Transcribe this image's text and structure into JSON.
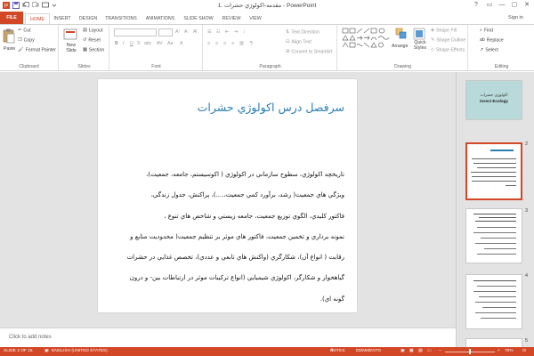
{
  "window": {
    "title": "مقدمه-اكولوژي حشرات .1 - PowerPoint",
    "signin": "Sign in",
    "controls": [
      "?",
      "▭",
      "—",
      "▢",
      "✕"
    ]
  },
  "tabs": [
    "FILE",
    "HOME",
    "INSERT",
    "DESIGN",
    "TRANSITIONS",
    "ANIMATIONS",
    "SLIDE SHOW",
    "REVIEW",
    "VIEW"
  ],
  "ribbon": {
    "clipboard": {
      "label": "Clipboard",
      "paste": "Paste",
      "cut": "Cut",
      "copy": "Copy",
      "format_painter": "Format Painter"
    },
    "slides": {
      "label": "Slides",
      "new_slide": "New Slide",
      "layout": "Layout",
      "reset": "Reset",
      "section": "Section"
    },
    "font": {
      "label": "Font"
    },
    "paragraph": {
      "label": "Paragraph",
      "text_direction": "Text Direction",
      "align_text": "Align Text",
      "convert": "Convert to SmartArt"
    },
    "drawing": {
      "label": "Drawing",
      "arrange": "Arrange",
      "quick_styles": "Quick Styles",
      "shape_fill": "Shape Fill",
      "shape_outline": "Shape Outline",
      "shape_effects": "Shape Effects"
    },
    "editing": {
      "label": "Editing",
      "find": "Find",
      "replace": "Replace",
      "select": "Select"
    }
  },
  "slide": {
    "title": "سرفصل درس اكولوژي حشرات",
    "body": [
      "تاريخچه اكولوژي، سطوح سازماني در اكولوژي ( اكوسيستم، جامعه، جمعيت)،",
      "ويژگي هاي جمعيت( رشد، برآورد كمي جمعيت،....)، پراكنش، جدول زندگي،",
      "فاكتور كليدي، الگوي توزيع جمعيت، جامعه زيستي و شاخص هاي تنوع ،",
      "نمونه برداري و تخمين جمعيت، فاكتور هاي موثر بر تنظيم جمعيت( محدوديت منابع و",
      "رقابت ( انواع آن)، شكارگري (واكنش هاي تابعي و عددي)، تخصص غذايي در حشرات",
      "گياهخوار و شكارگر، اكولوژي شيميايي (انواع تركيبات موثر در ارتباطات بين- و درون",
      "گونه اي)."
    ]
  },
  "notes": {
    "placeholder": "Click to add notes"
  },
  "thumbnails": [
    {
      "number": "1",
      "title_line1": "اكولوژي حشرات",
      "title_line2": "Insect Ecology",
      "bg": "#b8dadb"
    },
    {
      "number": "2"
    },
    {
      "number": "3"
    },
    {
      "number": "4"
    },
    {
      "number": "5"
    }
  ],
  "status": {
    "slide_of": "SLIDE 2 OF 15",
    "language": "ENGLISH (UNITED STATES)",
    "notes": "NOTES",
    "comments": "COMMENTS",
    "zoom": "70%"
  },
  "colors": {
    "accent": "#d24726",
    "title_blue": "#2a7db5",
    "thumb1_bg": "#b8dadb"
  }
}
